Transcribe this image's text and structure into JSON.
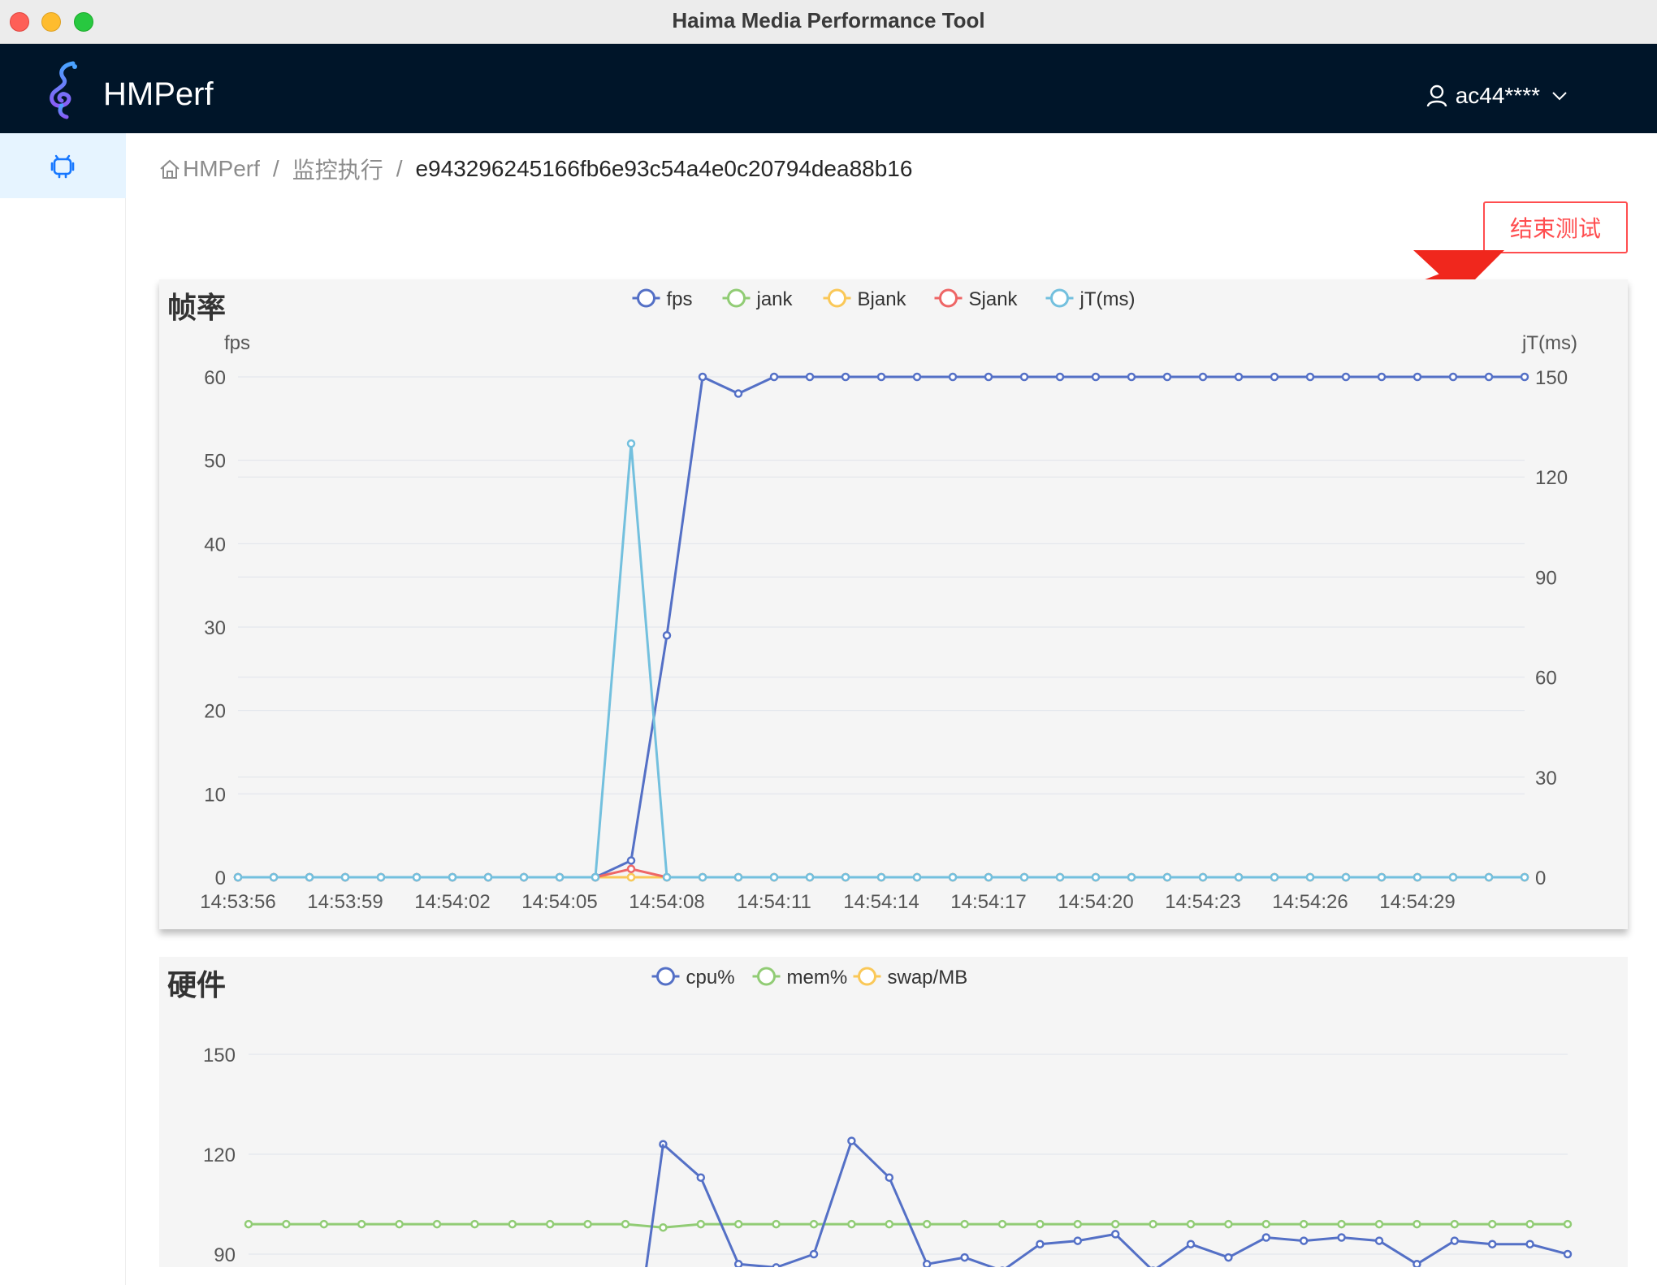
{
  "window": {
    "title": "Haima Media Performance Tool"
  },
  "header": {
    "brand": "HMPerf",
    "user": "ac44****"
  },
  "sidebar": {
    "items": [
      {
        "icon": "android-icon"
      }
    ]
  },
  "breadcrumb": {
    "home": "HMPerf",
    "section": "监控执行",
    "current": "e943296245166fb6e93c54a4e0c20794dea88b16"
  },
  "actions": {
    "end_test": "结束测试"
  },
  "colors": {
    "blue": "#5470c6",
    "green": "#91cc75",
    "yellow": "#fac858",
    "red": "#ee6666",
    "cyan": "#73c0de",
    "accent": "#ff4d4f"
  },
  "panels": {
    "fps_title": "帧率",
    "hw_title": "硬件"
  },
  "chart_data": [
    {
      "type": "line",
      "title": "帧率",
      "ylabel": "fps",
      "ylabel_right": "jT(ms)",
      "ylim": [
        0,
        60
      ],
      "ylim_right": [
        0,
        150
      ],
      "yticks": [
        "0",
        "10",
        "20",
        "30",
        "40",
        "50",
        "60"
      ],
      "yticks_right": [
        "0",
        "30",
        "60",
        "90",
        "120",
        "150"
      ],
      "x": [
        "14:53:56",
        "14:53:57",
        "14:53:58",
        "14:53:59",
        "14:54:00",
        "14:54:01",
        "14:54:02",
        "14:54:03",
        "14:54:04",
        "14:54:05",
        "14:54:06",
        "14:54:07",
        "14:54:08",
        "14:54:09",
        "14:54:10",
        "14:54:11",
        "14:54:12",
        "14:54:13",
        "14:54:14",
        "14:54:15",
        "14:54:16",
        "14:54:17",
        "14:54:18",
        "14:54:19",
        "14:54:20",
        "14:54:21",
        "14:54:22",
        "14:54:23",
        "14:54:24",
        "14:54:25",
        "14:54:26",
        "14:54:27",
        "14:54:28",
        "14:54:29",
        "14:54:30",
        "14:54:31",
        "14:54:32"
      ],
      "xticks": [
        "14:53:56",
        "14:53:59",
        "14:54:02",
        "14:54:05",
        "14:54:08",
        "14:54:11",
        "14:54:14",
        "14:54:17",
        "14:54:20",
        "14:54:23",
        "14:54:26",
        "14:54:29"
      ],
      "legend": [
        "fps",
        "jank",
        "Bjank",
        "Sjank",
        "jT(ms)"
      ],
      "series": [
        {
          "name": "fps",
          "axis": "left",
          "color": "#5470c6",
          "values": [
            0,
            0,
            0,
            0,
            0,
            0,
            0,
            0,
            0,
            0,
            0,
            2,
            29,
            60,
            58,
            60,
            60,
            60,
            60,
            60,
            60,
            60,
            60,
            60,
            60,
            60,
            60,
            60,
            60,
            60,
            60,
            60,
            60,
            60,
            60,
            60,
            60
          ]
        },
        {
          "name": "jank",
          "axis": "left",
          "color": "#91cc75",
          "values": [
            0,
            0,
            0,
            0,
            0,
            0,
            0,
            0,
            0,
            0,
            0,
            0,
            0,
            0,
            0,
            0,
            0,
            0,
            0,
            0,
            0,
            0,
            0,
            0,
            0,
            0,
            0,
            0,
            0,
            0,
            0,
            0,
            0,
            0,
            0,
            0,
            0
          ]
        },
        {
          "name": "Bjank",
          "axis": "left",
          "color": "#fac858",
          "values": [
            0,
            0,
            0,
            0,
            0,
            0,
            0,
            0,
            0,
            0,
            0,
            0,
            0,
            0,
            0,
            0,
            0,
            0,
            0,
            0,
            0,
            0,
            0,
            0,
            0,
            0,
            0,
            0,
            0,
            0,
            0,
            0,
            0,
            0,
            0,
            0,
            0
          ]
        },
        {
          "name": "Sjank",
          "axis": "left",
          "color": "#ee6666",
          "values": [
            0,
            0,
            0,
            0,
            0,
            0,
            0,
            0,
            0,
            0,
            0,
            1,
            0,
            0,
            0,
            0,
            0,
            0,
            0,
            0,
            0,
            0,
            0,
            0,
            0,
            0,
            0,
            0,
            0,
            0,
            0,
            0,
            0,
            0,
            0,
            0,
            0
          ]
        },
        {
          "name": "jT(ms)",
          "axis": "right",
          "color": "#73c0de",
          "values": [
            0,
            0,
            0,
            0,
            0,
            0,
            0,
            0,
            0,
            0,
            0,
            130,
            0,
            0,
            0,
            0,
            0,
            0,
            0,
            0,
            0,
            0,
            0,
            0,
            0,
            0,
            0,
            0,
            0,
            0,
            0,
            0,
            0,
            0,
            0,
            0,
            0
          ]
        }
      ]
    },
    {
      "type": "line",
      "title": "硬件",
      "yticks": [
        "90",
        "120",
        "150"
      ],
      "ylim": [
        90,
        150
      ],
      "legend": [
        "cpu%",
        "mem%",
        "swap/MB"
      ],
      "series": [
        {
          "name": "cpu%",
          "color": "#5470c6",
          "values": [
            null,
            null,
            null,
            null,
            null,
            null,
            null,
            null,
            null,
            null,
            null,
            123,
            113,
            87,
            86,
            90,
            124,
            113,
            87,
            89,
            85,
            93,
            94,
            96,
            85,
            93,
            89,
            95,
            94,
            95,
            94,
            87,
            94,
            93,
            93,
            90
          ]
        },
        {
          "name": "mem%",
          "color": "#91cc75",
          "values": [
            99,
            99,
            99,
            99,
            99,
            99,
            99,
            99,
            99,
            99,
            99,
            98,
            99,
            99,
            99,
            99,
            99,
            99,
            99,
            99,
            99,
            99,
            99,
            99,
            99,
            99,
            99,
            99,
            99,
            99,
            99,
            99,
            99,
            99,
            99,
            99
          ]
        },
        {
          "name": "swap/MB",
          "color": "#fac858",
          "values": []
        }
      ]
    }
  ]
}
